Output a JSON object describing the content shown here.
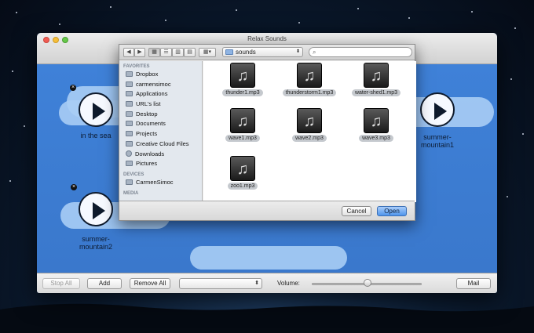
{
  "window": {
    "title": "Relax Sounds"
  },
  "sounds": [
    {
      "label": "in the sea"
    },
    {
      "label": "summer-\nmountain1"
    },
    {
      "label": "summer-\nmountain2"
    }
  ],
  "bottombar": {
    "stop_all": "Stop All",
    "add": "Add",
    "remove_all": "Remove All",
    "popup_arrows": "⬍",
    "volume_label": "Volume:",
    "mail": "Mail"
  },
  "dialog": {
    "path": "sounds",
    "search_placeholder": "",
    "sidebar": {
      "favorites_header": "FAVORITES",
      "favorites": [
        "Dropbox",
        "carmensimoc",
        "Applications",
        "URL's list",
        "Desktop",
        "Documents",
        "Projects",
        "Creative Cloud Files",
        "Downloads",
        "Pictures"
      ],
      "devices_header": "DEVICES",
      "devices": [
        "CarmenSimoc"
      ],
      "media_header": "MEDIA"
    },
    "files": [
      "thunder1.mp3",
      "thunderstorm1.mp3",
      "water-shed1.mp3",
      "wave1.mp3",
      "wave2.mp3",
      "wave3.mp3",
      "zoo1.mp3"
    ],
    "cancel": "Cancel",
    "open": "Open"
  },
  "colors": {
    "canvas": "#3c7cd2",
    "primary_button": "#4f95ec"
  }
}
